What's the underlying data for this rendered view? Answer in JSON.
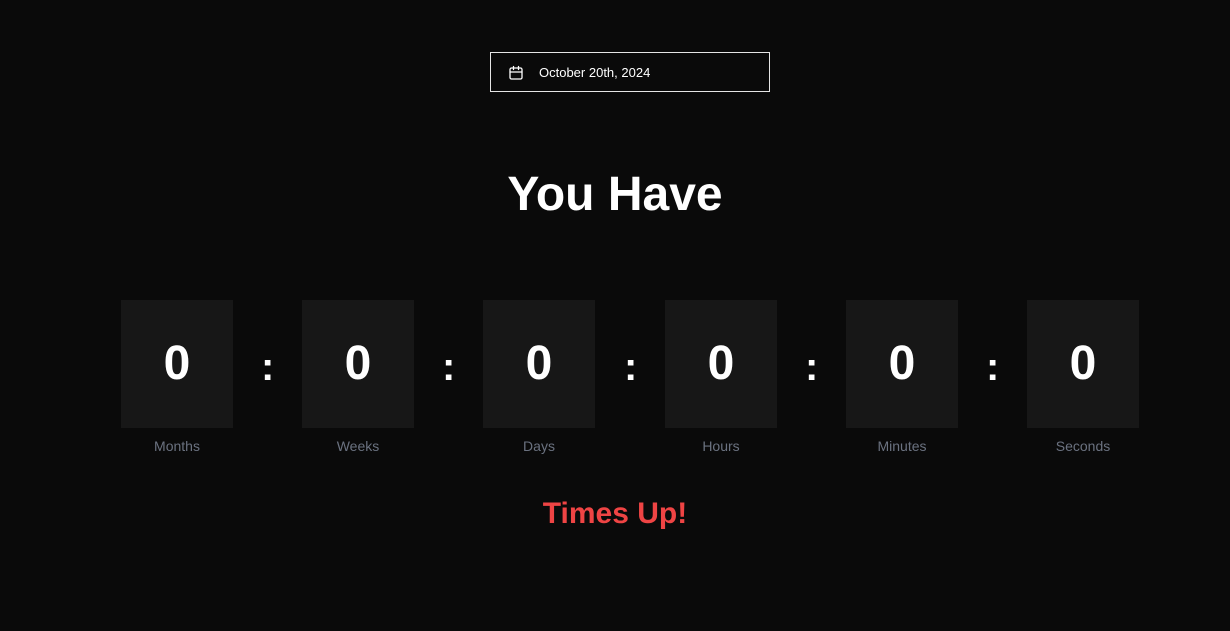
{
  "date_picker": {
    "icon": "calendar-icon",
    "value": "October 20th, 2024"
  },
  "heading": "You Have",
  "countdown": {
    "separator": ":",
    "units": [
      {
        "value": "0",
        "label": "Months"
      },
      {
        "value": "0",
        "label": "Weeks"
      },
      {
        "value": "0",
        "label": "Days"
      },
      {
        "value": "0",
        "label": "Hours"
      },
      {
        "value": "0",
        "label": "Minutes"
      },
      {
        "value": "0",
        "label": "Seconds"
      }
    ]
  },
  "status": {
    "text": "Times Up!",
    "color": "#ef4444"
  },
  "colors": {
    "background": "#0a0a0a",
    "box": "#171717",
    "label": "#6b7280"
  }
}
